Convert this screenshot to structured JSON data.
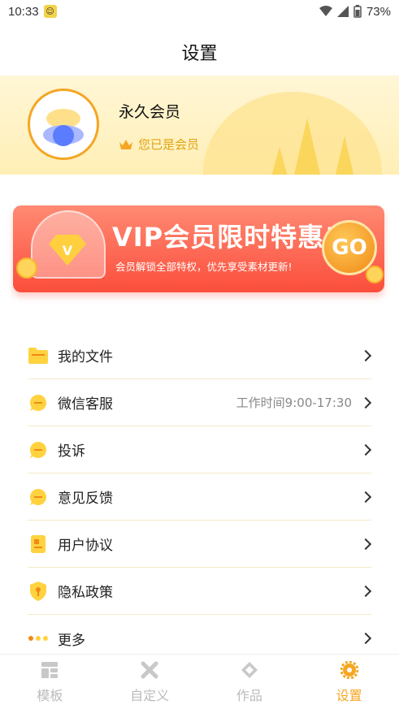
{
  "status_bar": {
    "time": "10:33",
    "battery": "73%"
  },
  "header": {
    "title": "设置"
  },
  "profile": {
    "name": "永久会员",
    "status": "您已是会员"
  },
  "banner": {
    "title": "VIP会员限时特惠!",
    "subtitle": "会员解锁全部特权，优先享受素材更新!",
    "go_label": "GO",
    "gem_letter": "V"
  },
  "menu": {
    "items": [
      {
        "label": "我的文件",
        "icon": "folder-icon",
        "extra": ""
      },
      {
        "label": "微信客服",
        "icon": "chat-icon",
        "extra": "工作时间9:00-17:30"
      },
      {
        "label": "投诉",
        "icon": "chat-icon",
        "extra": ""
      },
      {
        "label": "意见反馈",
        "icon": "chat-icon",
        "extra": ""
      },
      {
        "label": "用户协议",
        "icon": "document-icon",
        "extra": ""
      },
      {
        "label": "隐私政策",
        "icon": "shield-icon",
        "extra": ""
      },
      {
        "label": "更多",
        "icon": "more-icon",
        "extra": ""
      }
    ]
  },
  "tabbar": {
    "tabs": [
      {
        "label": "模板",
        "icon": "template-icon",
        "active": false
      },
      {
        "label": "自定义",
        "icon": "tools-icon",
        "active": false
      },
      {
        "label": "作品",
        "icon": "works-icon",
        "active": false
      },
      {
        "label": "设置",
        "icon": "gear-icon",
        "active": true
      }
    ]
  },
  "colors": {
    "accent": "#f5a623",
    "banner_red": "#fb4e3c",
    "icon_yellow": "#ffd23f"
  }
}
